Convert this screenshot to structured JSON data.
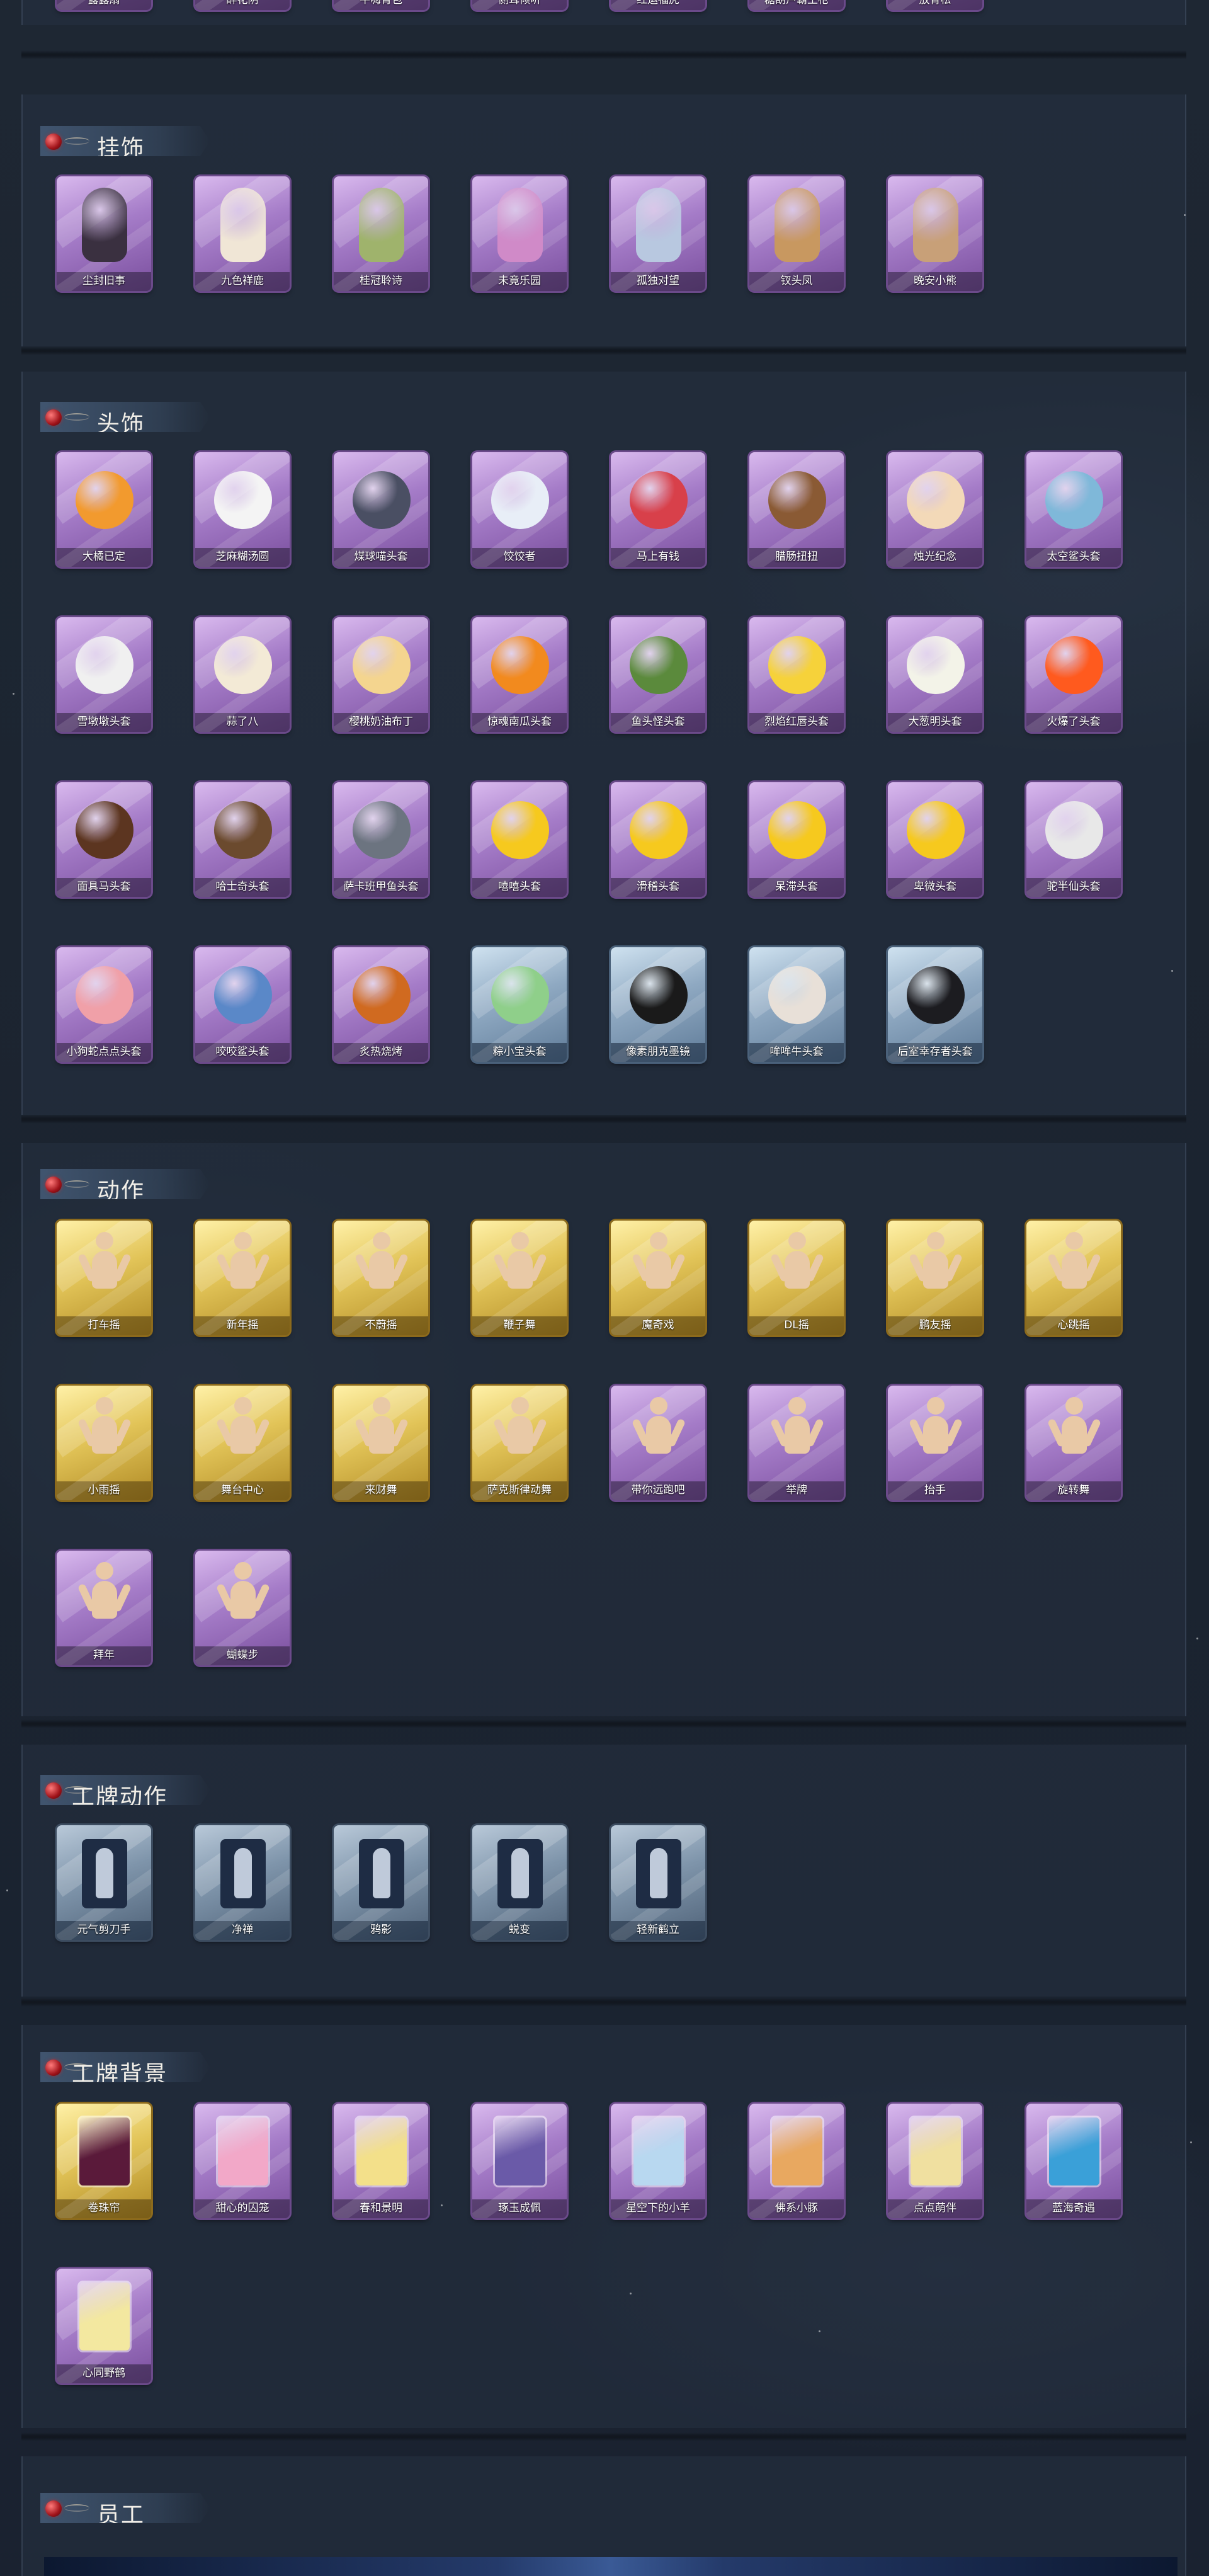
{
  "colors": {
    "background": "#1b232f",
    "purple_card": "#a57cc8",
    "gold_card": "#e2c458",
    "blue_card": "#8fa9c2",
    "title_text": "#f2efe8"
  },
  "top_row": {
    "items": [
      "露露扇",
      "醉花阴",
      "牛嗨背包",
      "侧耳倾听",
      "红运福虎",
      "糖葫芦霸王枪",
      "放青松"
    ]
  },
  "sections": {
    "pendant": {
      "title": "挂饰",
      "items": [
        "尘封旧事",
        "九色祥鹿",
        "桂冠聆诗",
        "未竟乐园",
        "孤独对望",
        "钗头凤",
        "晚安小熊"
      ]
    },
    "headwear": {
      "title": "头饰",
      "items": [
        "大橘已定",
        "芝麻糊汤圆",
        "煤球喵头套",
        "饺饺者",
        "马上有钱",
        "腊肠扭扭",
        "烛光纪念",
        "太空鲨头套",
        "雪墩墩头套",
        "蒜了八",
        "樱桃奶油布丁",
        "惊魂南瓜头套",
        "鱼头怪头套",
        "烈焰红唇头套",
        "大葱明头套",
        "火爆了头套",
        "面具马头套",
        "哈士奇头套",
        "萨卡班甲鱼头套",
        "嘻嘻头套",
        "滑稽头套",
        "呆滞头套",
        "卑微头套",
        "驼半仙头套",
        "小狗蛇点点头套",
        "咬咬鲨头套",
        "炙热烧烤",
        "粽小宝头套",
        "像素朋克墨镜",
        "哞哞牛头套",
        "后室幸存者头套"
      ]
    },
    "action": {
      "title": "动作",
      "items": [
        "打车摇",
        "新年摇",
        "不蔚摇",
        "鞭子舞",
        "魔奇戏",
        "DL摇",
        "鹏友摇",
        "心跳摇",
        "小雨摇",
        "舞台中心",
        "来财舞",
        "萨克斯律动舞",
        "带你远跑吧",
        "举牌",
        "抬手",
        "旋转舞",
        "拜年",
        "蝴蝶步"
      ]
    },
    "badge_action": {
      "title": "工牌动作",
      "items": [
        "元气剪刀手",
        "净禅",
        "鸦影",
        "蜕变",
        "轻新鹤立"
      ]
    },
    "badge_bg": {
      "title": "工牌背景",
      "items": [
        "卷珠帘",
        "甜心的囚笼",
        "春和景明",
        "琢玉成佩",
        "星空下的小羊",
        "佛系小豚",
        "点点萌伴",
        "蓝海奇遇",
        "心同野鹤"
      ]
    },
    "staff": {
      "title": "员工"
    }
  }
}
